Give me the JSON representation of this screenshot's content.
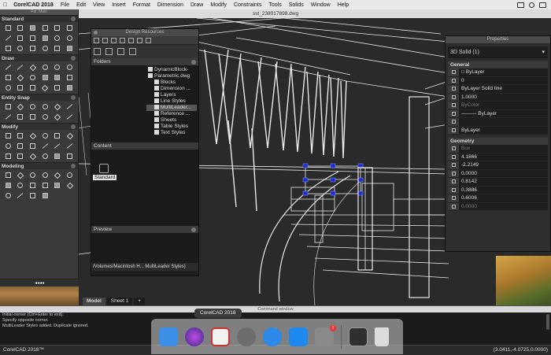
{
  "menubar": {
    "apple": "",
    "app": "CorelCAD 2018",
    "items": [
      "File",
      "Edit",
      "View",
      "Insert",
      "Format",
      "Dimension",
      "Draw",
      "Modify",
      "Constraints",
      "Tools",
      "Solids",
      "Window",
      "Help"
    ]
  },
  "document": {
    "title": "sst_238017898.dwg"
  },
  "palette": {
    "top_label": "Pal: Main",
    "sections": [
      "Standard",
      "Draw",
      "Entity Snap",
      "Modify",
      "Modeling"
    ],
    "collapse": "◂◂◂◂"
  },
  "design_resources": {
    "title": "Design Resources",
    "folders_label": "Folders",
    "tree": [
      {
        "label": "DynamicBlock-",
        "level": 0
      },
      {
        "label": "Parametric.dwg",
        "level": 0
      },
      {
        "label": "Blocks",
        "level": 1
      },
      {
        "label": "Dimension ...",
        "level": 1
      },
      {
        "label": "Layers",
        "level": 1
      },
      {
        "label": "Line Styles",
        "level": 1
      },
      {
        "label": "MultiLeader...",
        "level": 1,
        "selected": true
      },
      {
        "label": "Reference ...",
        "level": 1
      },
      {
        "label": "Sheets",
        "level": 1
      },
      {
        "label": "Table Styles",
        "level": 1
      },
      {
        "label": "Text Styles",
        "level": 1
      }
    ],
    "content_label": "Content",
    "content_item": "Standard",
    "preview_label": "Preview",
    "path": "/Volumes/Macintosh H... MultiLeader Styles)"
  },
  "properties": {
    "title": "Properties",
    "selection": "3D Solid (1)",
    "general_label": "General",
    "general": [
      {
        "icon": "color-icon",
        "value": "□ ByLayer"
      },
      {
        "icon": "layer-icon",
        "value": "0"
      },
      {
        "icon": "linestyle-icon",
        "value": "ByLayer    Solid line"
      },
      {
        "icon": "linescale-icon",
        "value": "1.0000"
      },
      {
        "icon": "transparency-icon",
        "value": "ByColor",
        "dim": true
      },
      {
        "icon": "lineweight-icon",
        "value": "——— ByLayer"
      },
      {
        "icon": "hyperlink-icon",
        "value": ""
      },
      {
        "icon": "plotstyle-icon",
        "value": "ByLayer"
      }
    ],
    "geometry_label": "Geometry",
    "geometry": [
      {
        "icon": "solidtype-icon",
        "value": "Box",
        "dim": true
      },
      {
        "icon": "position-x-icon",
        "value": "4.1866"
      },
      {
        "icon": "position-y-icon",
        "value": "-2.2149"
      },
      {
        "icon": "position-z-icon",
        "value": "0.0000"
      },
      {
        "icon": "length-icon",
        "value": "0.8142"
      },
      {
        "icon": "width-icon",
        "value": "0.3886"
      },
      {
        "icon": "height-icon",
        "value": "0.6006"
      },
      {
        "icon": "rotation-icon",
        "value": "0.0000",
        "dim": true
      }
    ]
  },
  "layout_tabs": [
    "Model",
    "Sheet 1",
    "+"
  ],
  "command": {
    "title": "Command window",
    "lines": [
      "Initial corner (Ctrl+Enter to exit):",
      "Specify opposite corner.",
      "",
      "MultiLeader Styles added. Duplicate ignored."
    ]
  },
  "status": {
    "left": "CorelCAD 2018™",
    "coords": "(3.0411,-4.0725,0.0000)"
  },
  "dock": {
    "tooltip": "CorelCAD 2018",
    "items": [
      {
        "name": "finder-icon",
        "color": "#3c8fe6"
      },
      {
        "name": "siri-icon",
        "color": "#6a3fb8"
      },
      {
        "name": "corelcad-icon",
        "color": "#f1f1f1"
      },
      {
        "name": "launchpad-icon",
        "color": "#777"
      },
      {
        "name": "safari-icon",
        "color": "#2d8ae8"
      },
      {
        "name": "app-store-icon",
        "color": "#1e8af0"
      },
      {
        "name": "system-preferences-icon",
        "color": "#8a8a8a",
        "badge": "1"
      },
      {
        "name": "activity-monitor-icon",
        "color": "#2f2f2f"
      },
      {
        "name": "trash-icon",
        "color": "#dcdcdc"
      }
    ]
  }
}
